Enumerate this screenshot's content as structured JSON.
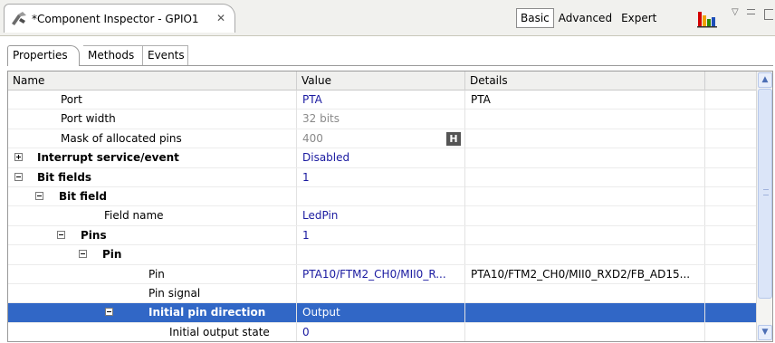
{
  "view": {
    "title": "*Component Inspector - GPIO1",
    "close_glyph": "✕",
    "modes": [
      "Basic",
      "Advanced",
      "Expert"
    ],
    "active_mode": "Basic",
    "icons": [
      "component-icon",
      "chart-icon",
      "view-menu-icon",
      "minimize-icon",
      "maximize-icon"
    ]
  },
  "tabs": [
    "Properties",
    "Methods",
    "Events"
  ],
  "table": {
    "columns": [
      "Name",
      "Value",
      "Details"
    ],
    "rows": [
      {
        "name": "Port",
        "value": "PTA",
        "details": "PTA"
      },
      {
        "name": "Port width",
        "value": "32 bits",
        "details": ""
      },
      {
        "name": "Mask of allocated pins",
        "value": "400",
        "details": "",
        "button": "H"
      },
      {
        "name": "Interrupt service/event",
        "value": "Disabled",
        "details": ""
      },
      {
        "name": "Bit fields",
        "value": "1",
        "details": ""
      },
      {
        "name": "Bit field",
        "value": "",
        "details": ""
      },
      {
        "name": "Field name",
        "value": "LedPin",
        "details": ""
      },
      {
        "name": "Pins",
        "value": "1",
        "details": ""
      },
      {
        "name": "Pin",
        "value": "",
        "details": ""
      },
      {
        "name": "Pin",
        "value": "PTA10/FTM2_CH0/MII0_R...",
        "details": "PTA10/FTM2_CH0/MII0_RXD2/FB_AD15..."
      },
      {
        "name": "Pin signal",
        "value": "",
        "details": ""
      },
      {
        "name": "Initial pin direction",
        "value": "Output",
        "details": ""
      },
      {
        "name": "Initial output state",
        "value": "0",
        "details": ""
      }
    ]
  },
  "colors": {
    "selection": "#3167c6",
    "value_text": "#1a1aa0"
  }
}
